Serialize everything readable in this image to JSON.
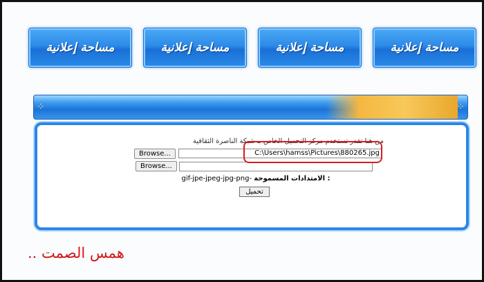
{
  "ads": [
    {
      "label": "مساحة إعلانية"
    },
    {
      "label": "مساحة إعلانية"
    },
    {
      "label": "مساحة إعلانية"
    },
    {
      "label": "مساحة إعلانية"
    }
  ],
  "upload_form": {
    "hint_text": "من هنا تقدر تستخدم مركز التحميل الخاص بـ شبكة الناصرة الثقافية",
    "browse_label": "Browse...",
    "file1_value": "C:\\Users\\hamss\\Pictures\\880265.jpg",
    "file2_value": "",
    "allowed_label": "الامتدادات المسموحة :",
    "allowed_value": "gif-jpe-jpeg-jpg-png-",
    "upload_button": "تحميل"
  },
  "signature": "همس الصمت ..",
  "colors": {
    "accent_blue": "#2b86e6",
    "highlight_red": "#d61c1c",
    "signature_red": "#d31515"
  }
}
